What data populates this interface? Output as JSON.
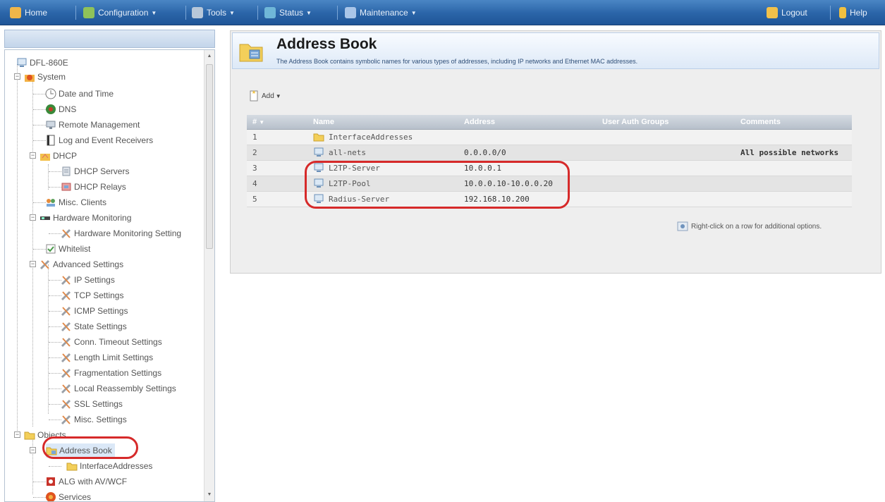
{
  "menubar": {
    "items": [
      {
        "label": "Home",
        "icon": "home-icon",
        "caret": false
      },
      {
        "label": "Configuration",
        "icon": "configuration-icon",
        "caret": true
      },
      {
        "label": "Tools",
        "icon": "tools-icon",
        "caret": true
      },
      {
        "label": "Status",
        "icon": "status-icon",
        "caret": true
      },
      {
        "label": "Maintenance",
        "icon": "maintenance-icon",
        "caret": true
      }
    ],
    "logout": "Logout",
    "help": "Help"
  },
  "sidebar": {
    "root": "DFL-860E",
    "nodes": [
      {
        "label": "System"
      },
      {
        "label": "Date and Time"
      },
      {
        "label": "DNS"
      },
      {
        "label": "Remote Management"
      },
      {
        "label": "Log and Event Receivers"
      },
      {
        "label": "DHCP"
      },
      {
        "label": "DHCP Servers"
      },
      {
        "label": "DHCP Relays"
      },
      {
        "label": "Misc. Clients"
      },
      {
        "label": "Hardware Monitoring"
      },
      {
        "label": "Hardware Monitoring Setting"
      },
      {
        "label": "Whitelist"
      },
      {
        "label": "Advanced Settings"
      },
      {
        "label": "IP Settings"
      },
      {
        "label": "TCP Settings"
      },
      {
        "label": "ICMP Settings"
      },
      {
        "label": "State Settings"
      },
      {
        "label": "Conn. Timeout Settings"
      },
      {
        "label": "Length Limit Settings"
      },
      {
        "label": "Fragmentation Settings"
      },
      {
        "label": "Local Reassembly Settings"
      },
      {
        "label": "SSL Settings"
      },
      {
        "label": "Misc. Settings"
      },
      {
        "label": "Objects"
      },
      {
        "label": "Address Book"
      },
      {
        "label": "InterfaceAddresses"
      },
      {
        "label": "ALG with AV/WCF"
      },
      {
        "label": "Services"
      }
    ]
  },
  "main": {
    "title": "Address Book",
    "subtitle": "The Address Book contains symbolic names for various types of addresses, including IP networks and Ethernet MAC addresses.",
    "add_label": "Add",
    "columns": [
      "#",
      "Name",
      "Address",
      "User Auth Groups",
      "Comments"
    ],
    "rows": [
      {
        "num": "1",
        "name": "InterfaceAddresses",
        "address": "",
        "groups": "",
        "comments": "",
        "icon": "folder-icon"
      },
      {
        "num": "2",
        "name": "all-nets",
        "address": "0.0.0.0/0",
        "groups": "",
        "comments": "All possible networks",
        "icon": "network-address-icon"
      },
      {
        "num": "3",
        "name": "L2TP-Server",
        "address": "10.0.0.1",
        "groups": "",
        "comments": "",
        "icon": "network-address-icon"
      },
      {
        "num": "4",
        "name": "L2TP-Pool",
        "address": "10.0.0.10-10.0.0.20",
        "groups": "",
        "comments": "",
        "icon": "network-address-icon"
      },
      {
        "num": "5",
        "name": "Radius-Server",
        "address": "192.168.10.200",
        "groups": "",
        "comments": "",
        "icon": "network-address-icon"
      }
    ],
    "hint": "Right-click on a row for additional options."
  },
  "colors": {
    "menubar": "#2a64a8",
    "highlight": "#d62a2a",
    "table_header": "#b7c0cb"
  }
}
